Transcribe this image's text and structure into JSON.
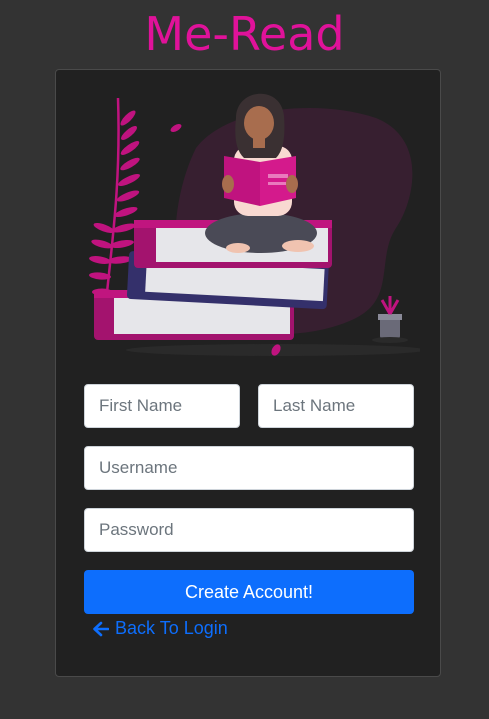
{
  "app": {
    "title": "Me-Read"
  },
  "form": {
    "first_name": {
      "placeholder": "First Name",
      "value": ""
    },
    "last_name": {
      "placeholder": "Last Name",
      "value": ""
    },
    "username": {
      "placeholder": "Username",
      "value": ""
    },
    "password": {
      "placeholder": "Password",
      "value": ""
    },
    "submit_label": "Create Account!",
    "back_label": "Back To Login"
  },
  "icons": {
    "back": "arrow-left-icon",
    "illustration": "reading-woman-on-books-illustration"
  },
  "colors": {
    "brand": "#e0129a",
    "primary": "#0d6efd",
    "background": "#333333",
    "card": "#212121"
  }
}
